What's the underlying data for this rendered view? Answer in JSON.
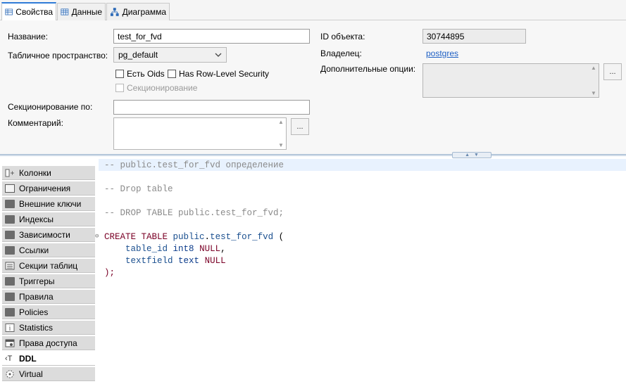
{
  "tabs": [
    {
      "label": "Свойства",
      "icon": "properties-icon"
    },
    {
      "label": "Данные",
      "icon": "data-grid-icon"
    },
    {
      "label": "Диаграмма",
      "icon": "diagram-icon"
    }
  ],
  "properties": {
    "name_label": "Название:",
    "name_value": "test_for_fvd",
    "tablespace_label": "Табличное пространство:",
    "tablespace_value": "pg_default",
    "has_oids_label": "Есть Oids",
    "rls_label": "Has Row-Level Security",
    "partitioning_label": "Секционирование",
    "partition_by_label": "Секционирование по:",
    "partition_by_value": "",
    "comment_label": "Комментарий:",
    "object_id_label": "ID объекта:",
    "object_id_value": "30744895",
    "owner_label": "Владелец:",
    "owner_value": "postgres",
    "extra_options_label": "Дополнительные опции:",
    "more_button_label": "..."
  },
  "nav": {
    "items": [
      {
        "label": "Колонки",
        "icon": "columns-icon"
      },
      {
        "label": "Ограничения",
        "icon": "constraints-icon"
      },
      {
        "label": "Внешние ключи",
        "icon": "folder-icon"
      },
      {
        "label": "Индексы",
        "icon": "folder-icon"
      },
      {
        "label": "Зависимости",
        "icon": "folder-icon"
      },
      {
        "label": "Ссылки",
        "icon": "folder-icon"
      },
      {
        "label": "Секции таблиц",
        "icon": "partitions-icon"
      },
      {
        "label": "Триггеры",
        "icon": "folder-icon"
      },
      {
        "label": "Правила",
        "icon": "folder-icon"
      },
      {
        "label": "Policies",
        "icon": "folder-icon"
      },
      {
        "label": "Statistics",
        "icon": "info-icon"
      },
      {
        "label": "Права доступа",
        "icon": "permissions-icon"
      },
      {
        "label": "DDL",
        "icon": "ddl-icon",
        "selected": true
      },
      {
        "label": "Virtual",
        "icon": "virtual-icon"
      }
    ]
  },
  "ddl": {
    "line1": "-- public.test_for_fvd определение",
    "line2": "-- Drop table",
    "line3": "-- DROP TABLE public.test_for_fvd;",
    "create_kw": "CREATE TABLE",
    "schema": "public",
    "table": "test_for_fvd",
    "open_paren": "(",
    "col1_name": "table_id",
    "col1_type": "int8",
    "col2_name": "textfield",
    "col2_type": "text",
    "null_kw": "NULL",
    "close": ");"
  },
  "colors": {
    "accent": "#2f7bd8",
    "comment": "#8a8a8a",
    "keyword": "#7a0026",
    "identifier": "#1a4f8f",
    "link": "#1d5fc4"
  }
}
